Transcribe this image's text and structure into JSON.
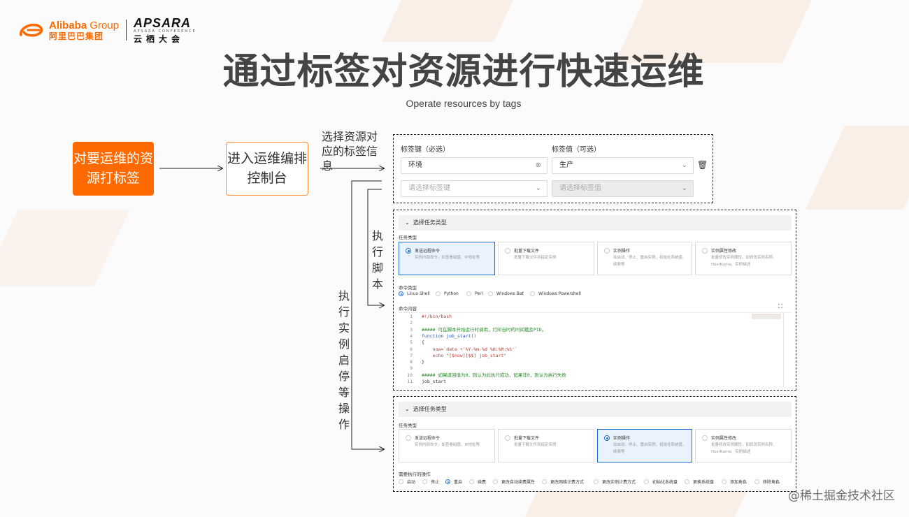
{
  "branding": {
    "alibaba_en": "Alibaba",
    "alibaba_group": " Group",
    "alibaba_cn": "阿里巴巴集团",
    "apsara": "APSARA",
    "apsara_sub": "APSARA CONFERENCE",
    "apsara_cn": "云栖大会"
  },
  "title": "通过标签对资源进行快速运维",
  "subtitle": "Operate resources by tags",
  "flow": {
    "step1": "对要运维的资源打标签",
    "step2": "进入运维编排控制台",
    "label_select_tags": "选择资源对应的标签信息",
    "label_run_script": "执行脚本",
    "label_instance_ops": "执行实例启停等操作"
  },
  "tag_panel": {
    "key_label": "标签键（必选）",
    "value_label": "标签值（可选）",
    "key_value": "环境",
    "value_value": "生产",
    "key_placeholder": "请选择标签键",
    "value_placeholder": "请选择标签值"
  },
  "script_panel": {
    "section_title": "选择任务类型",
    "task_type_label": "任务类型",
    "cards": [
      {
        "title": "发送远程命令",
        "desc": "实例内部命令，如查看磁盘、IP地址等",
        "selected": true
      },
      {
        "title": "批量下载文件",
        "desc": "批量下载文件到指定实例",
        "selected": false
      },
      {
        "title": "实例操作",
        "desc": "如启动、停止、重启实例，初始化系统盘、续费等",
        "selected": false
      },
      {
        "title": "实例属性修改",
        "desc": "批量修改实例属性，如修改实例名称、HostName、实例描述",
        "selected": false
      }
    ],
    "cmd_type_label": "命令类型",
    "cmd_types": [
      "Linux Shell",
      "Python",
      "Perl",
      "Windows Bat",
      "Windows Powershell"
    ],
    "cmd_content_label": "命令内容",
    "code_lines": [
      {
        "n": "1",
        "t": "#!/bin/bash",
        "c": "r"
      },
      {
        "n": "2",
        "t": "",
        "c": "b"
      },
      {
        "n": "3",
        "t": "##### 可在脚本开始运行时调用，打印当时的时间戳及PID。",
        "c": "g"
      },
      {
        "n": "4",
        "t": "function job_start()",
        "c": "k"
      },
      {
        "n": "5",
        "t": "{",
        "c": "b"
      },
      {
        "n": "6",
        "t": "    now=`date +'%Y-%m-%d %H:%M:%S'`",
        "c": "r"
      },
      {
        "n": "7",
        "t": "    echo \"[$now][$$] job_start\"",
        "c": "r"
      },
      {
        "n": "8",
        "t": "}",
        "c": "b"
      },
      {
        "n": "9",
        "t": "",
        "c": "b"
      },
      {
        "n": "10",
        "t": "##### 如果返回值为0，则认为此执行成功，如果非0，则认为执行失败",
        "c": "g"
      },
      {
        "n": "11",
        "t": "job_start",
        "c": "b"
      }
    ]
  },
  "ops_panel": {
    "section_title": "选择任务类型",
    "task_type_label": "任务类型",
    "cards": [
      {
        "title": "发送远程命令",
        "desc": "实例内部命令，如查看磁盘、IP地址等",
        "selected": false
      },
      {
        "title": "批量下载文件",
        "desc": "批量下载文件到指定实例",
        "selected": false
      },
      {
        "title": "实例操作",
        "desc": "如启动、停止、重启实例，初始化系统盘、续费等",
        "selected": true
      },
      {
        "title": "实例属性修改",
        "desc": "批量修改实例属性，如修改实例名称、HostName、实例描述",
        "selected": false
      }
    ],
    "ops_label": "需要执行的操作",
    "ops": [
      "启动",
      "停止",
      "重启",
      "续费",
      "更改自动续费属性",
      "更改网络计费方式",
      "更改实例计费方式",
      "初始化系统盘",
      "更换系统盘",
      "添加角色",
      "移除角色"
    ],
    "selected_op": 2
  },
  "watermark": "@稀土掘金技术社区"
}
